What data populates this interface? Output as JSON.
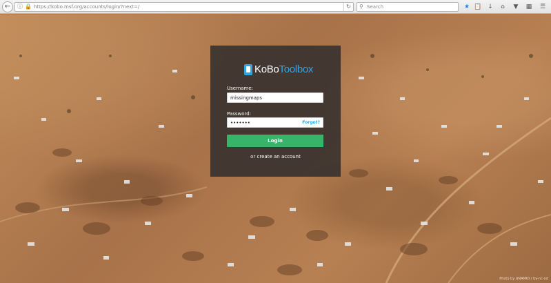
{
  "browser": {
    "url": "https://kobo.msf.org/accounts/login/?next=/",
    "search_placeholder": "Search"
  },
  "login": {
    "logo_kobo": "KoBo",
    "logo_toolbox": "Toolbox",
    "username_label": "Username:",
    "username_value": "missingmaps",
    "password_label": "Password:",
    "password_value": "•••••••",
    "forgot_label": "Forgot?",
    "login_button": "Login",
    "create_prefix": "or",
    "create_link": "create an account"
  },
  "background": {
    "credit": "Photo by UNAMID / by-nc-nd"
  },
  "colors": {
    "accent_blue": "#2fa4e7",
    "login_green": "#37b46a",
    "card_bg": "#3a342f"
  },
  "icons": [
    "back-icon",
    "info-icon",
    "lock-icon",
    "reload-icon",
    "search-icon",
    "bookmark-star-icon",
    "clipboard-icon",
    "download-icon",
    "home-icon",
    "pocket-icon",
    "reader-icon",
    "menu-icon"
  ]
}
